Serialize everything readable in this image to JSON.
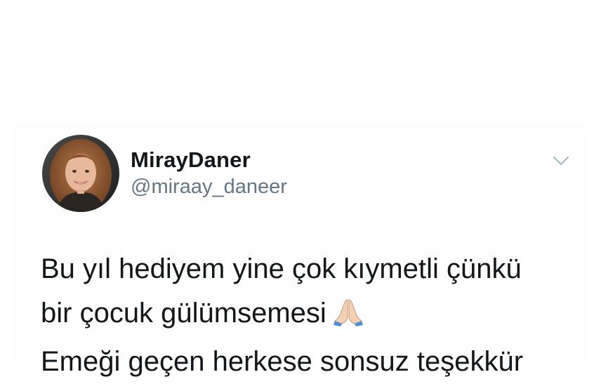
{
  "tweet": {
    "author": {
      "display_name": "MirayDaner",
      "handle": "@miraay_daneer"
    },
    "menu_icon": "chevron-down-icon",
    "text_lines": [
      "Bu yıl hediyem yine çok kıymetli çünkü",
      "bir çocuk gülümsemesi",
      "Emeği geçen herkese sonsuz teşekkür"
    ],
    "emoji": "folded-hands-icon"
  },
  "colors": {
    "name": "#14171a",
    "handle": "#657786",
    "chevron": "#aab8c2"
  }
}
